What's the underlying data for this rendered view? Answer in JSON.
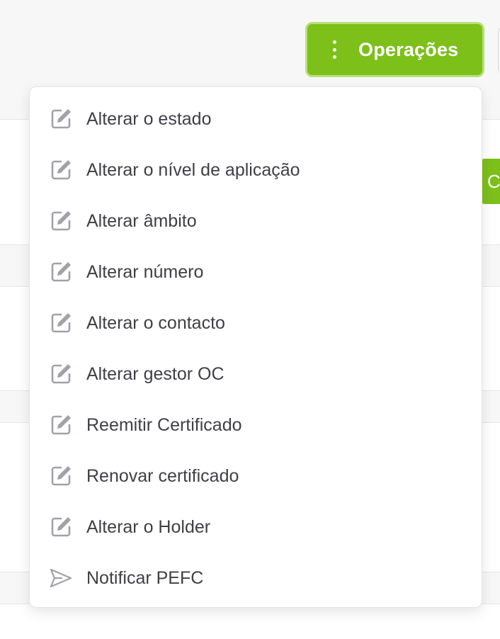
{
  "header": {
    "operations_button_label": "Operações",
    "operations_button_icon": "vertical-dots-icon",
    "background_tab_partial_text": "C"
  },
  "menu": {
    "items": [
      {
        "label": "Alterar o estado",
        "icon": "edit-icon"
      },
      {
        "label": "Alterar o nível de aplicação",
        "icon": "edit-icon"
      },
      {
        "label": "Alterar âmbito",
        "icon": "edit-icon"
      },
      {
        "label": "Alterar número",
        "icon": "edit-icon"
      },
      {
        "label": "Alterar o contacto",
        "icon": "edit-icon"
      },
      {
        "label": "Alterar gestor OC",
        "icon": "edit-icon"
      },
      {
        "label": "Reemitir Certificado",
        "icon": "edit-icon"
      },
      {
        "label": "Renovar certificado",
        "icon": "edit-icon"
      },
      {
        "label": "Alterar o Holder",
        "icon": "edit-icon"
      },
      {
        "label": "Notificar PEFC",
        "icon": "send-icon"
      }
    ]
  },
  "colors": {
    "accent_green": "#7cc019",
    "accent_green_border": "#b9e07a",
    "icon_gray": "#a1a1aa",
    "text": "#3f3f46"
  }
}
